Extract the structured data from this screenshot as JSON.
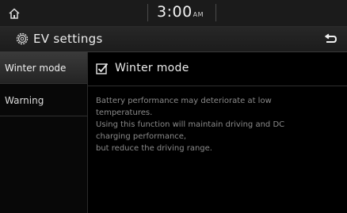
{
  "status_bar": {
    "home_icon": "home-icon",
    "time": "3:00",
    "ampm": "AM"
  },
  "title_bar": {
    "gear_icon": "gear-icon",
    "title": "EV settings",
    "back_icon": "back-arrow-icon"
  },
  "tabs": [
    {
      "label": "Winter mode",
      "active": true
    },
    {
      "label": "Warning",
      "active": false
    }
  ],
  "option": {
    "label": "Winter mode",
    "checked": true
  },
  "description_lines": [
    "Battery performance may deteriorate at low",
    "temperatures.",
    "Using this function will maintain driving and DC",
    "charging performance,",
    "but reduce the driving range."
  ],
  "colors": {
    "background": "#000000",
    "text": "#e6e6e6",
    "description_text": "#8a8a8a"
  }
}
